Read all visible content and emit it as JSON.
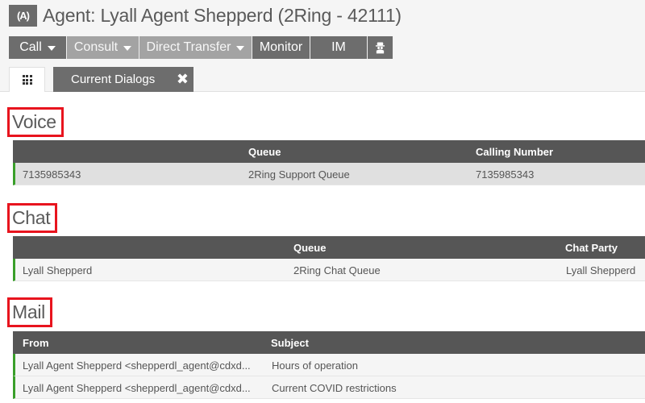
{
  "header": {
    "icon": "antenna-agent-icon",
    "title": "Agent: Lyall Agent Shepperd (2Ring - 42111)"
  },
  "toolbar": {
    "call_label": "Call",
    "consult_label": "Consult",
    "direct_transfer_label": "Direct Transfer",
    "monitor_label": "Monitor",
    "im_label": "IM",
    "incognito_icon": "agent-incognito-icon"
  },
  "tabs": {
    "grid_icon": "grid-icon",
    "current_label": "Current Dialogs",
    "close_glyph": "✖"
  },
  "sections": {
    "voice": {
      "title": "Voice",
      "columns": [
        "",
        "Queue",
        "Calling Number"
      ],
      "rows": [
        [
          "7135985343",
          "2Ring Support Queue",
          "7135985343"
        ]
      ]
    },
    "chat": {
      "title": "Chat",
      "columns": [
        "",
        "Queue",
        "Chat Party"
      ],
      "rows": [
        [
          "Lyall Shepperd",
          "2Ring Chat Queue",
          "Lyall Shepperd"
        ]
      ]
    },
    "mail": {
      "title": "Mail",
      "columns": [
        "From",
        "Subject"
      ],
      "rows": [
        [
          "Lyall Agent Shepperd <shepperdl_agent@cdxd...",
          "Hours of operation"
        ],
        [
          "Lyall Agent Shepperd <shepperdl_agent@cdxd...",
          "Current COVID restrictions"
        ]
      ]
    }
  },
  "colors": {
    "highlight_border": "#e8141e",
    "status_bar": "#3a9f2a",
    "table_header": "#565656"
  }
}
